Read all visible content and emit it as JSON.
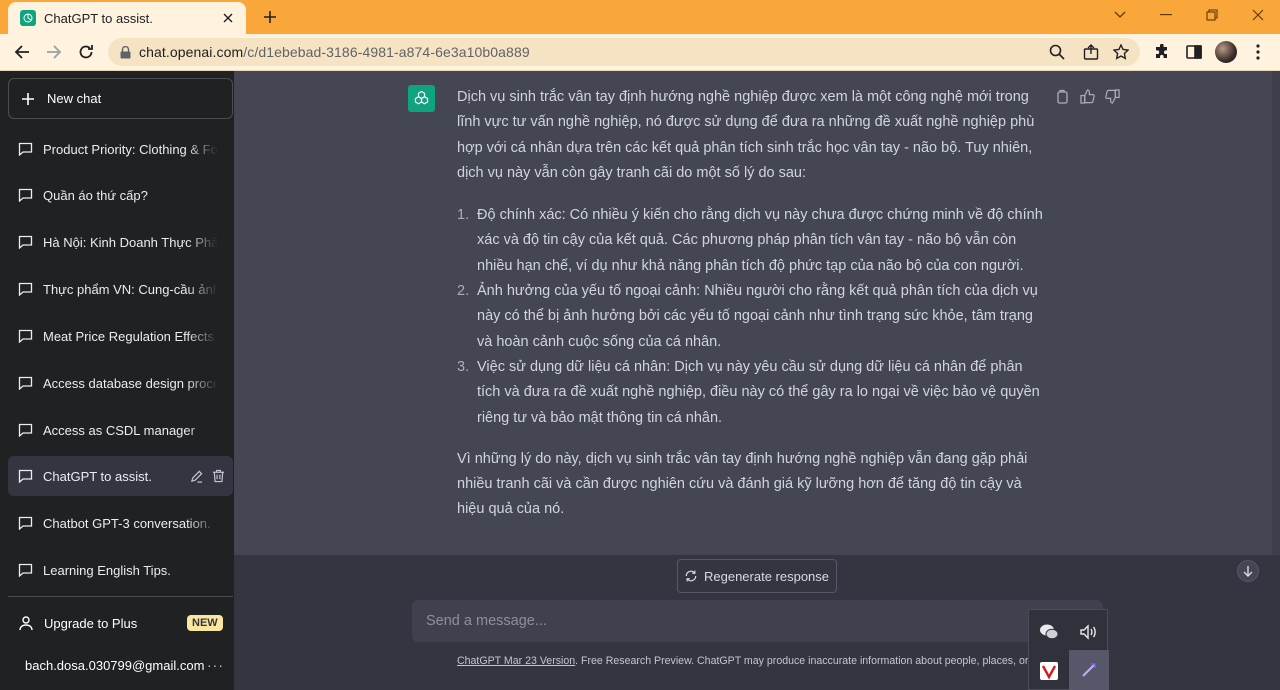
{
  "browser": {
    "tab_title": "ChatGPT to assist.",
    "url_host": "chat.openai.com",
    "url_path": "/c/d1ebebad-3186-4981-a874-6e3a10b0a889",
    "accent_color": "#f9a73a"
  },
  "sidebar": {
    "new_chat_label": "New chat",
    "conversations": [
      {
        "label": "Product Priority: Clothing & Food"
      },
      {
        "label": "Quần áo thứ cấp?"
      },
      {
        "label": "Hà Nội: Kinh Doanh Thực Phẩm"
      },
      {
        "label": "Thực phẩm VN: Cung-cầu ảnh hưởng"
      },
      {
        "label": "Meat Price Regulation Effects"
      },
      {
        "label": "Access database design process"
      },
      {
        "label": "Access as CSDL manager"
      },
      {
        "label": "ChatGPT to assist.",
        "active": true
      },
      {
        "label": "Chatbot GPT-3 conversation."
      },
      {
        "label": "Learning English Tips."
      }
    ],
    "upgrade_label": "Upgrade to Plus",
    "new_badge": "NEW",
    "account_email": "bach.dosa.030799@gmail.com",
    "account_menu": "···"
  },
  "message": {
    "intro": "Dịch vụ sinh trắc vân tay định hướng nghề nghiệp được xem là một công nghệ mới trong lĩnh vực tư vấn nghề nghiệp, nó được sử dụng để đưa ra những đề xuất nghề nghiệp phù hợp với cá nhân dựa trên các kết quả phân tích sinh trắc học vân tay - não bộ. Tuy nhiên, dịch vụ này vẫn còn gây tranh cãi do một số lý do sau:",
    "points": [
      {
        "num": "1.",
        "text": "Độ chính xác: Có nhiều ý kiến cho rằng dịch vụ này chưa được chứng minh về độ chính xác và độ tin cậy của kết quả. Các phương pháp phân tích vân tay - não bộ vẫn còn nhiều hạn chế, ví dụ như khả năng phân tích độ phức tạp của não bộ của con người."
      },
      {
        "num": "2.",
        "text": "Ảnh hưởng của yếu tố ngoại cảnh: Nhiều người cho rằng kết quả phân tích của dịch vụ này có thể bị ảnh hưởng bởi các yếu tố ngoại cảnh như tình trạng sức khỏe, tâm trạng và hoàn cảnh cuộc sống của cá nhân."
      },
      {
        "num": "3.",
        "text": "Việc sử dụng dữ liệu cá nhân: Dịch vụ này yêu cầu sử dụng dữ liệu cá nhân để phân tích và đưa ra đề xuất nghề nghiệp, điều này có thể gây ra lo ngại về việc bảo vệ quyền riêng tư và bảo mật thông tin cá nhân."
      }
    ],
    "conclusion": "Vì những lý do này, dịch vụ sinh trắc vân tay định hướng nghề nghiệp vẫn đang gặp phải nhiều tranh cãi và cần được nghiên cứu và đánh giá kỹ lưỡng hơn để tăng độ tin cậy và hiệu quả của nó."
  },
  "composer": {
    "regenerate_label": "Regenerate response",
    "placeholder": "Send a message..."
  },
  "footer": {
    "version_link": "ChatGPT Mar 23 Version",
    "note": ". Free Research Preview. ChatGPT may produce inaccurate information about people, places, or facts."
  },
  "icons": {
    "brand_green": "#10a37f",
    "composer_bg": "#40414f",
    "sidebar_bg": "#202123",
    "badge_color": "#fae69e"
  }
}
